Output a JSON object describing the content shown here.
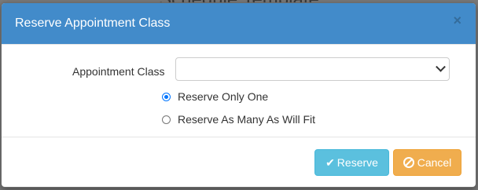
{
  "backdrop": {
    "title": "Schedule Template"
  },
  "modal": {
    "title": "Reserve Appointment Class",
    "close_glyph": "×"
  },
  "form": {
    "appointment_class_label": "Appointment Class",
    "appointment_class_value": "",
    "options": [
      {
        "label": "Reserve Only One",
        "checked": true
      },
      {
        "label": "Reserve As Many As Will Fit",
        "checked": false
      }
    ]
  },
  "footer": {
    "reserve_label": "Reserve",
    "cancel_label": "Cancel"
  },
  "icons": {
    "reserve": "check-icon",
    "cancel": "ban-icon"
  },
  "colors": {
    "header": "#428bca",
    "reserve": "#5bc0de",
    "cancel": "#f0ad4e"
  }
}
